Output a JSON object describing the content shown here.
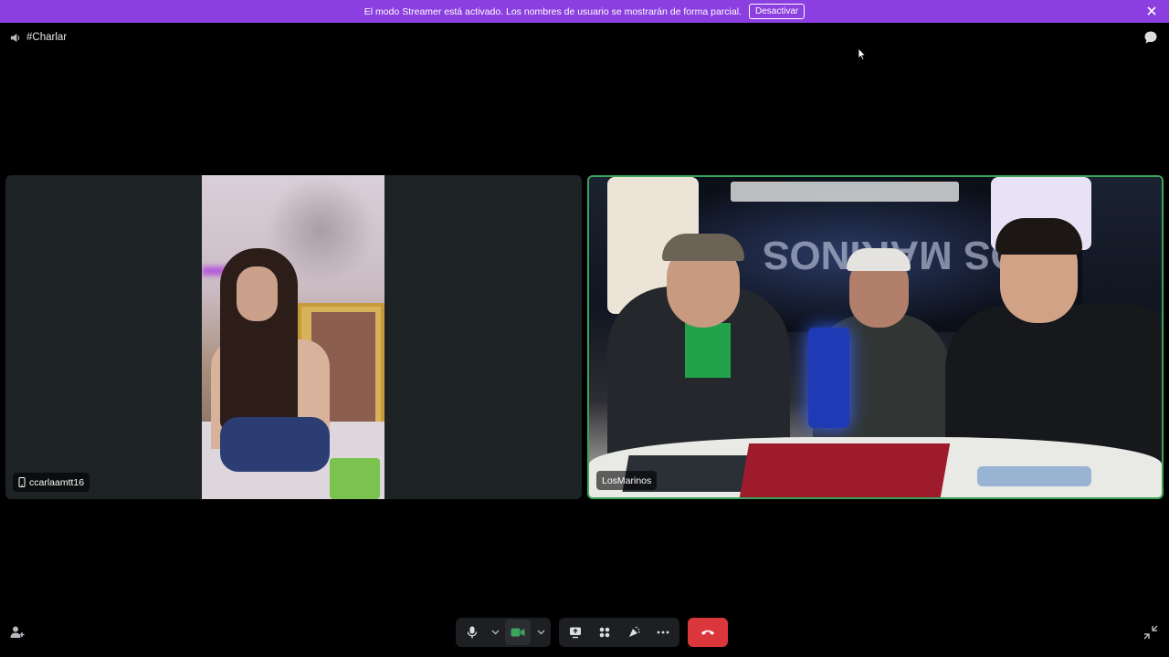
{
  "banner": {
    "message": "El modo Streamer está activado. Los nombres de usuario se mostrarán de forma parcial.",
    "button_label": "Desactivar",
    "background": "#8b3fe0"
  },
  "channel": {
    "name": "#Charlar",
    "icon": "speaker-icon"
  },
  "participants": [
    {
      "name": "ccarlaamtt16",
      "device_icon": "mobile-icon",
      "speaking": false
    },
    {
      "name": "LosMarinos",
      "speaking": true,
      "speaking_color": "#3ba55c"
    }
  ],
  "controls": {
    "mic_icon": "microphone-icon",
    "camera_icon": "camera-icon",
    "camera_color": "#3ba55c",
    "screen_share_icon": "screen-share-icon",
    "activities_icon": "activities-icon",
    "soundboard_icon": "soundboard-icon",
    "more_icon": "more-icon",
    "end_call_icon": "phone-hangup-icon",
    "end_call_color": "#da373c"
  }
}
